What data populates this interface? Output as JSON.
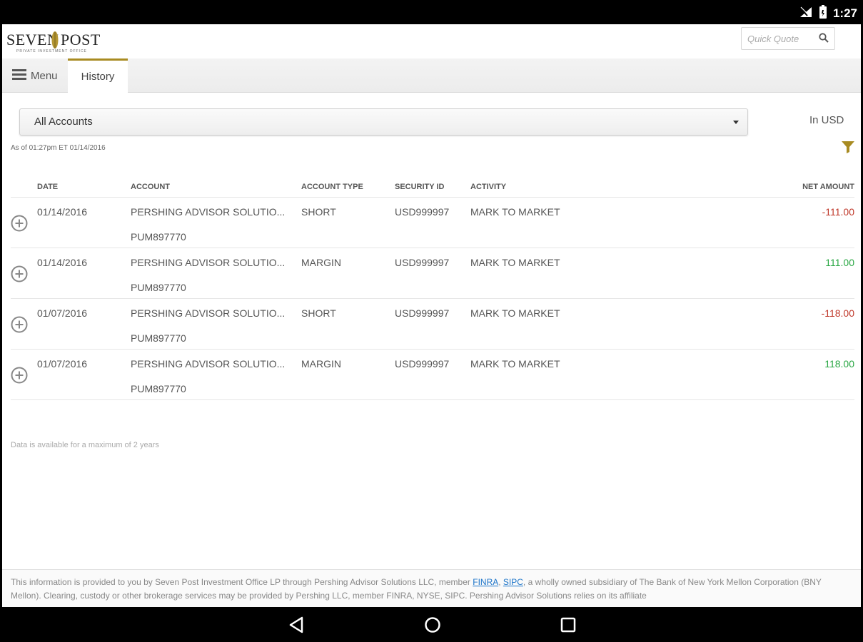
{
  "status_bar": {
    "time": "1:27"
  },
  "header": {
    "logo": {
      "text_left": "SEVEN",
      "text_right": "POST",
      "subtitle": "PRIVATE INVESTMENT OFFICE"
    },
    "quick_quote": {
      "placeholder": "Quick Quote"
    }
  },
  "nav": {
    "menu_label": "Menu",
    "active_tab": "History"
  },
  "filters": {
    "account_select": "All Accounts",
    "currency": "In USD",
    "as_of": "As of 01:27pm ET 01/14/2016"
  },
  "table": {
    "columns": [
      "DATE",
      "ACCOUNT",
      "ACCOUNT TYPE",
      "SECURITY ID",
      "ACTIVITY",
      "NET AMOUNT"
    ],
    "rows": [
      {
        "date": "01/14/2016",
        "account": "PERSHING ADVISOR SOLUTIO...",
        "account_no": "PUM897770",
        "account_type": "SHORT",
        "security_id": "USD999997",
        "activity": "MARK TO MARKET",
        "net_amount": "-111.00",
        "sign": "negative"
      },
      {
        "date": "01/14/2016",
        "account": "PERSHING ADVISOR SOLUTIO...",
        "account_no": "PUM897770",
        "account_type": "MARGIN",
        "security_id": "USD999997",
        "activity": "MARK TO MARKET",
        "net_amount": "111.00",
        "sign": "positive"
      },
      {
        "date": "01/07/2016",
        "account": "PERSHING ADVISOR SOLUTIO...",
        "account_no": "PUM897770",
        "account_type": "SHORT",
        "security_id": "USD999997",
        "activity": "MARK TO MARKET",
        "net_amount": "-118.00",
        "sign": "negative"
      },
      {
        "date": "01/07/2016",
        "account": "PERSHING ADVISOR SOLUTIO...",
        "account_no": "PUM897770",
        "account_type": "MARGIN",
        "security_id": "USD999997",
        "activity": "MARK TO MARKET",
        "net_amount": "118.00",
        "sign": "positive"
      }
    ]
  },
  "note": "Data is available for a maximum of 2 years",
  "footer": {
    "text_before": "This information is provided to you by Seven Post Investment Office LP through Pershing Advisor Solutions LLC, member ",
    "link_finra": "FINRA",
    "sep": ", ",
    "link_sipc": "SIPC",
    "text_after": ", a wholly owned subsidiary of The Bank of New York Mellon Corporation (BNY Mellon). Clearing, custody or other brokerage services may be provided by Pershing LLC, member FINRA, NYSE, SIPC. Pershing Advisor Solutions relies on its affiliate"
  },
  "colors": {
    "accent_gold": "#a88b22",
    "negative": "#c0392b",
    "positive": "#2aa744"
  },
  "icons": {
    "status": [
      "signal-off-icon",
      "battery-icon"
    ],
    "search": "search-icon",
    "menu": "hamburger-icon",
    "filter": "filter-icon",
    "row_expand": "plus-circle-icon",
    "nav": [
      "back-icon",
      "home-icon",
      "recents-icon"
    ]
  }
}
